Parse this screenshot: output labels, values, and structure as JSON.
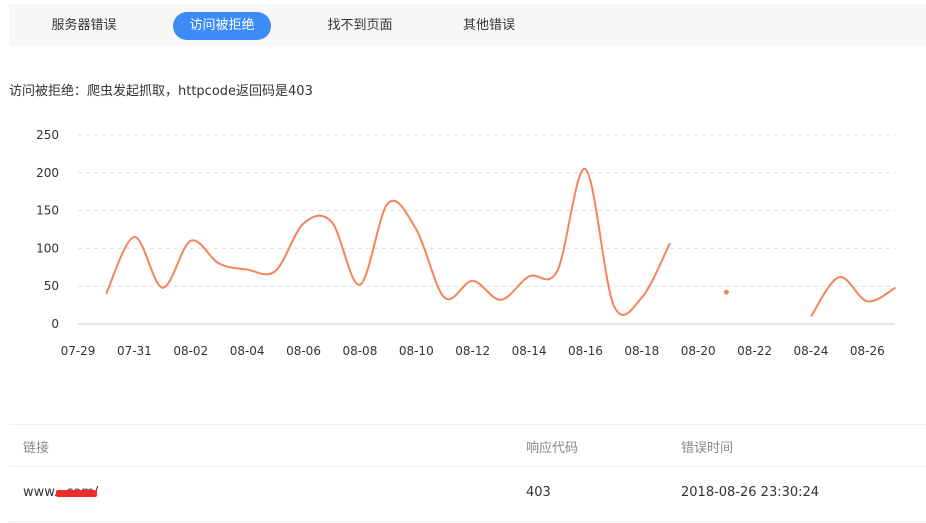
{
  "tabs": [
    {
      "label": "服务器错误",
      "active": false
    },
    {
      "label": "访问被拒绝",
      "active": true
    },
    {
      "label": "找不到页面",
      "active": false
    },
    {
      "label": "其他错误",
      "active": false
    }
  ],
  "description": "访问被拒绝：爬虫发起抓取，httpcode返回码是403",
  "colors": {
    "accent": "#3d8bf7",
    "line": "#f6835b",
    "link": "#3a63d9"
  },
  "chart_data": {
    "type": "line",
    "x": [
      "07-29",
      "07-30",
      "07-31",
      "08-01",
      "08-02",
      "08-03",
      "08-04",
      "08-05",
      "08-06",
      "08-07",
      "08-08",
      "08-09",
      "08-10",
      "08-11",
      "08-12",
      "08-13",
      "08-14",
      "08-15",
      "08-16",
      "08-17",
      "08-18",
      "08-19",
      "08-20",
      "08-21",
      "08-22",
      "08-23",
      "08-24",
      "08-25",
      "08-26",
      "08-27"
    ],
    "series": [
      {
        "values": [
          null,
          40,
          115,
          48,
          110,
          80,
          72,
          70,
          133,
          135,
          52,
          160,
          125,
          35,
          57,
          32,
          63,
          70,
          205,
          25,
          35,
          107,
          null,
          42,
          null,
          null,
          10,
          62,
          30,
          48
        ]
      }
    ],
    "xticks": [
      "07-29",
      "07-31",
      "08-02",
      "08-04",
      "08-06",
      "08-08",
      "08-10",
      "08-12",
      "08-14",
      "08-16",
      "08-18",
      "08-20",
      "08-22",
      "08-24",
      "08-26"
    ],
    "yticks": [
      0,
      50,
      100,
      150,
      200,
      250
    ],
    "ylim": [
      0,
      250
    ],
    "grid": true,
    "legend": "none"
  },
  "table": {
    "headers": {
      "link": "链接",
      "code": "响应代码",
      "time": "错误时间"
    },
    "rows": [
      {
        "link": "www.        .com/",
        "code": "403",
        "time": "2018-08-26 23:30:24"
      }
    ]
  }
}
